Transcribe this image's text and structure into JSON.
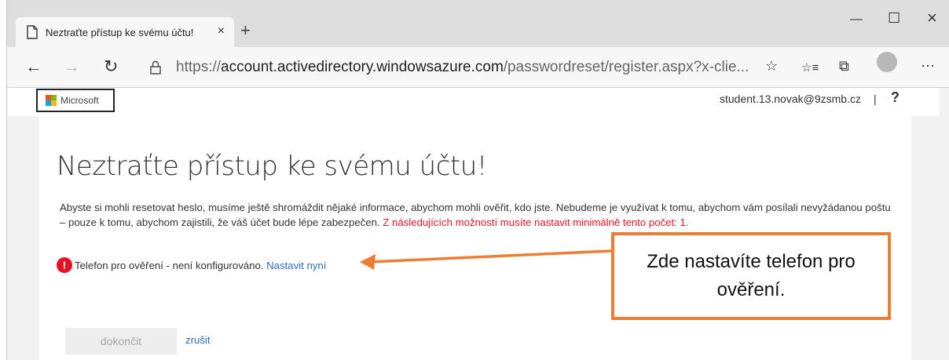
{
  "browser": {
    "tab_title": "Neztraťte přístup ke svému účtu!",
    "tab_close": "×",
    "new_tab": "+",
    "url_prefix": "https://",
    "url_host": "account.activedirectory.windowsazure.com",
    "url_path": "/passwordreset/register.aspx?x-clie...",
    "window": {
      "minimize": "—",
      "maximize": "☐",
      "close": "×"
    },
    "nav": {
      "back": "←",
      "forward": "→",
      "refresh": "↻"
    },
    "toolbar_icons": {
      "favorite": "☆",
      "favorites": "☆≡",
      "collections": "⧉",
      "more": "⋯"
    }
  },
  "header": {
    "logo_text": "Microsoft",
    "user_email": "student.13.novak@9zsmb.cz",
    "separator": "|",
    "help": "?"
  },
  "main": {
    "title": "Neztraťte přístup ke svému účtu!",
    "description": "Abyste si mohli resetovat heslo, musíme ještě shromáždit nějaké informace, abychom mohli ověřit, kdo jste. Nebudeme je využívat k tomu, abychom vám posílali nevyžádanou poštu – pouze k tomu, abychom zajistili, že váš účet bude lépe zabezpečen.",
    "requirement": "Z následujících možností musíte nastavit minimálně tento počet: 1.",
    "phone_status": "Telefon pro ověření - není konfigurováno.",
    "setup_link": "Nastavit nyní",
    "warning_glyph": "!",
    "finish_button": "dokončit",
    "cancel_link": "zrušit"
  },
  "annotation": {
    "text": "Zde nastavíte telefon pro ověření.",
    "color": "#ed7d31"
  },
  "colors": {
    "error": "#e81123",
    "link": "#2a6ebb"
  }
}
